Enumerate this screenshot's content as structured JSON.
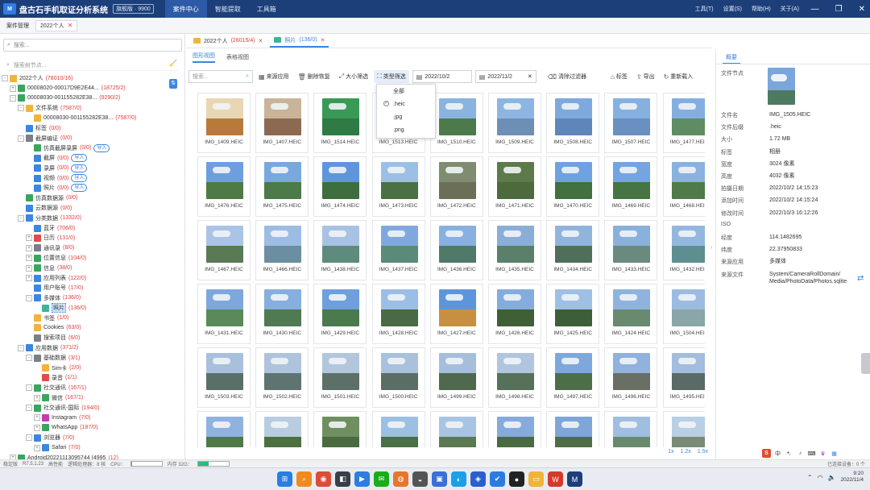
{
  "titlebar": {
    "app_title": "盘古石手机取证分析系统",
    "version": "旗舰版 · 9900",
    "nav": [
      "案件中心",
      "智能提取",
      "工具箱"
    ],
    "right_menu": [
      "工具(T)",
      "设置(S)",
      "帮助(H)",
      "关于(A)"
    ]
  },
  "breadcrumb": {
    "items": [
      "案件管理",
      "2022个人"
    ]
  },
  "left": {
    "search_placeholder": "搜索...",
    "tree_search_placeholder": "搜索树节点...",
    "tree": [
      {
        "label": "2022个人",
        "count": "(78010/16)",
        "indent": 0,
        "toggle": "-",
        "color": "#f0b43c"
      },
      {
        "label": "00008020-00017D9E2E44...",
        "count": "(18725/2)",
        "indent": 1,
        "toggle": "+",
        "color": "#3aa55d"
      },
      {
        "label": "00008030-001155282E38...",
        "count": "(9290/2)",
        "indent": 1,
        "toggle": "-",
        "color": "#3aa55d"
      },
      {
        "label": "文件系统",
        "count": "(7587/0)",
        "indent": 2,
        "toggle": "-",
        "color": "#f0b43c"
      },
      {
        "label": "00008030-001155282E38...",
        "count": "(7587/0)",
        "indent": 3,
        "toggle": "",
        "color": "#f0b43c"
      },
      {
        "label": "标签",
        "count": "(0/0)",
        "indent": 2,
        "toggle": "",
        "color": "#3b87e0"
      },
      {
        "label": "截屏编证",
        "count": "(0/0)",
        "indent": 2,
        "toggle": "-",
        "color": "#7a7f88"
      },
      {
        "label": "仿真截屏录屏",
        "count": "(0/0)",
        "indent": 3,
        "toggle": "",
        "color": "#3aa55d",
        "import": "导入"
      },
      {
        "label": "截屏",
        "count": "(0/0)",
        "indent": 3,
        "toggle": "",
        "color": "#3b87e0",
        "import": "导入"
      },
      {
        "label": "录屏",
        "count": "(0/0)",
        "indent": 3,
        "toggle": "",
        "color": "#3b87e0",
        "import": "导入"
      },
      {
        "label": "视频",
        "count": "(0/0)",
        "indent": 3,
        "toggle": "",
        "color": "#3b87e0",
        "import": "导入"
      },
      {
        "label": "照片",
        "count": "(0/0)",
        "indent": 3,
        "toggle": "",
        "color": "#3b87e0",
        "import": "导入"
      },
      {
        "label": "仿真数据源",
        "count": "(0/0)",
        "indent": 2,
        "toggle": "",
        "color": "#3aa55d"
      },
      {
        "label": "云数据源",
        "count": "(0/0)",
        "indent": 2,
        "toggle": "",
        "color": "#3b87e0"
      },
      {
        "label": "分类数据",
        "count": "(1332/0)",
        "indent": 2,
        "toggle": "-",
        "color": "#3b87e0"
      },
      {
        "label": "蓝牙",
        "count": "(706/0)",
        "indent": 3,
        "toggle": "",
        "color": "#3b87e0"
      },
      {
        "label": "日历",
        "count": "(131/0)",
        "indent": 3,
        "toggle": "+",
        "color": "#e24b4b"
      },
      {
        "label": "通讯录",
        "count": "(8/0)",
        "indent": 3,
        "toggle": "+",
        "color": "#7a7f88"
      },
      {
        "label": "位置信息",
        "count": "(104/0)",
        "indent": 3,
        "toggle": "+",
        "color": "#3aa55d"
      },
      {
        "label": "信息",
        "count": "(38/0)",
        "indent": 3,
        "toggle": "+",
        "color": "#3aa55d"
      },
      {
        "label": "应用列表",
        "count": "(122/0)",
        "indent": 3,
        "toggle": "+",
        "color": "#3b87e0"
      },
      {
        "label": "用户账号",
        "count": "(17/0)",
        "indent": 3,
        "toggle": "",
        "color": "#3b87e0"
      },
      {
        "label": "多媒体",
        "count": "(136/0)",
        "indent": 3,
        "toggle": "-",
        "color": "#3b87e0"
      },
      {
        "label": "照片",
        "count": "(136/0)",
        "indent": 4,
        "toggle": "",
        "color": "#3fb29a",
        "selected": true
      },
      {
        "label": "书签",
        "count": "(1/0)",
        "indent": 3,
        "toggle": "",
        "color": "#f0b43c"
      },
      {
        "label": "Cookies",
        "count": "(63/0)",
        "indent": 3,
        "toggle": "",
        "color": "#f0b43c"
      },
      {
        "label": "搜索项目",
        "count": "(6/0)",
        "indent": 3,
        "toggle": "",
        "color": "#7a7f88"
      },
      {
        "label": "应用数据",
        "count": "(371/2)",
        "indent": 2,
        "toggle": "-",
        "color": "#3b87e0"
      },
      {
        "label": "基础数据",
        "count": "(3/1)",
        "indent": 3,
        "toggle": "-",
        "color": "#7a7f88"
      },
      {
        "label": "Sim卡",
        "count": "(2/0)",
        "indent": 4,
        "toggle": "",
        "color": "#f0b43c"
      },
      {
        "label": "录音",
        "count": "(1/1)",
        "indent": 4,
        "toggle": "",
        "color": "#e24b4b"
      },
      {
        "label": "社交通讯",
        "count": "(167/1)",
        "indent": 3,
        "toggle": "-",
        "color": "#3aa55d"
      },
      {
        "label": "微信",
        "count": "(167/1)",
        "indent": 4,
        "toggle": "+",
        "color": "#3aa55d"
      },
      {
        "label": "社交通讯-国际",
        "count": "(194/0)",
        "indent": 3,
        "toggle": "-",
        "color": "#3aa55d"
      },
      {
        "label": "Instagram",
        "count": "(7/0)",
        "indent": 4,
        "toggle": "+",
        "color": "#c63cb0"
      },
      {
        "label": "WhatsApp",
        "count": "(187/0)",
        "indent": 4,
        "toggle": "+",
        "color": "#3aa55d"
      },
      {
        "label": "浏览器",
        "count": "(7/0)",
        "indent": 3,
        "toggle": "-",
        "color": "#3b87e0"
      },
      {
        "label": "Safari",
        "count": "(7/0)",
        "indent": 4,
        "toggle": "+",
        "color": "#3b87e0"
      },
      {
        "label": "Android20221113095744 (4995",
        "count": "(12)",
        "indent": 1,
        "toggle": "+",
        "color": "#3aa55d"
      }
    ]
  },
  "center": {
    "doc_tabs": [
      {
        "label": "2022个人",
        "count": "(28015/4)"
      },
      {
        "label": "照片",
        "count": "(136/0)"
      }
    ],
    "view_tabs": [
      "图形视图",
      "表格视图"
    ],
    "toolbar": {
      "search_placeholder": "搜索...",
      "source_app": "来源应用",
      "delete_recover": "删除恢复",
      "size_filter": "大小筛选",
      "type_filter": "类型筛选",
      "date_start": "2022/10/2",
      "date_end": "2022/11/2",
      "clear_filter": "清除过滤器",
      "tag": "标签",
      "export": "导出",
      "reload": "重新载入"
    },
    "type_dropdown": [
      {
        "label": "全部",
        "checked": false
      },
      {
        "label": ".heic",
        "checked": true
      },
      {
        "label": ".jpg",
        "checked": false
      },
      {
        "label": ".png",
        "checked": false
      }
    ],
    "thumbnails": [
      {
        "name": "IMG_1409.HEIC",
        "sky": "#e9d6b4",
        "land": "#b87a3a"
      },
      {
        "name": "IMG_1407.HEIC",
        "sky": "#c9b49a",
        "land": "#8c6a52"
      },
      {
        "name": "IMG_1514.HEIC",
        "sky": "#3a9a55",
        "land": "#2f7a45"
      },
      {
        "name": "IMG_1513.HEIC",
        "sky": "#7aa6d6",
        "land": "#4f6e3f"
      },
      {
        "name": "IMG_1510.HEIC",
        "sky": "#89b4e0",
        "land": "#4d7a4a"
      },
      {
        "name": "IMG_1509.HEIC",
        "sky": "#8db5e2",
        "land": "#6d8fb5"
      },
      {
        "name": "IMG_1508.HEIC",
        "sky": "#7ea9dc",
        "land": "#5e86b8"
      },
      {
        "name": "IMG_1507.HEIC",
        "sky": "#86b0e0",
        "land": "#6990c0"
      },
      {
        "name": "IMG_1477.HEIC",
        "sky": "#84aee0",
        "land": "#5f8c62"
      },
      {
        "name": "IMG_1476.HEIC",
        "sky": "#6d9fde",
        "land": "#4f7a44"
      },
      {
        "name": "IMG_1475.HEIC",
        "sky": "#79a8df",
        "land": "#4c7a48"
      },
      {
        "name": "IMG_1474.HEIC",
        "sky": "#5f96db",
        "land": "#3f6e3e"
      },
      {
        "name": "IMG_1473.HEIC",
        "sky": "#9cbfe6",
        "land": "#4a7044"
      },
      {
        "name": "IMG_1472.HEIC",
        "sky": "#7f8c70",
        "land": "#6b6f58"
      },
      {
        "name": "IMG_1471.HEIC",
        "sky": "#5c7a4a",
        "land": "#4d6a3d"
      },
      {
        "name": "IMG_1470.HEIC",
        "sky": "#6fa2e0",
        "land": "#42703f"
      },
      {
        "name": "IMG_1469.HEIC",
        "sky": "#74a5e0",
        "land": "#467443"
      },
      {
        "name": "IMG_1468.HEIC",
        "sky": "#8ab1e0",
        "land": "#4f7a4a"
      },
      {
        "name": "IMG_1467.HEIC",
        "sky": "#a9c4e6",
        "land": "#5a7a55"
      },
      {
        "name": "IMG_1466.HEIC",
        "sky": "#9dbce4",
        "land": "#6b8fa0"
      },
      {
        "name": "IMG_1438.HEIC",
        "sky": "#a7c2e4",
        "land": "#5f8a7e"
      },
      {
        "name": "IMG_1437.HEIC",
        "sky": "#7fa9de",
        "land": "#5a8a78"
      },
      {
        "name": "IMG_1436.HEIC",
        "sky": "#88b0e0",
        "land": "#4f7a6a"
      },
      {
        "name": "IMG_1435.HEIC",
        "sky": "#8aaed8",
        "land": "#5a7f6a"
      },
      {
        "name": "IMG_1434.HEIC",
        "sky": "#91b4dc",
        "land": "#4f6f5a"
      },
      {
        "name": "IMG_1433.HEIC",
        "sky": "#8ab0dc",
        "land": "#6a8a80"
      },
      {
        "name": "IMG_1432.HEIC",
        "sky": "#94b7e0",
        "land": "#5d8f90"
      },
      {
        "name": "IMG_1431.HEIC",
        "sky": "#7ea8dc",
        "land": "#5a8a5a"
      },
      {
        "name": "IMG_1430.HEIC",
        "sky": "#86aede",
        "land": "#4f7a52"
      },
      {
        "name": "IMG_1429.HEIC",
        "sky": "#6f9fdc",
        "land": "#4a7a4e"
      },
      {
        "name": "IMG_1428.HEIC",
        "sky": "#9cbde6",
        "land": "#4a6a45"
      },
      {
        "name": "IMG_1427.HEIC",
        "sky": "#5d95dc",
        "land": "#c78f42"
      },
      {
        "name": "IMG_1426.HEIC",
        "sky": "#84acdc",
        "land": "#3f5f35"
      },
      {
        "name": "IMG_1425.HEIC",
        "sky": "#9fbfe4",
        "land": "#3d5e38"
      },
      {
        "name": "IMG_1424.HEIC",
        "sky": "#8fb3de",
        "land": "#6a8a6f"
      },
      {
        "name": "IMG_1504.HEIC",
        "sky": "#9cbbe0",
        "land": "#8aa6a8"
      },
      {
        "name": "IMG_1503.HEIC",
        "sky": "#a8c0dc",
        "land": "#5a6f68"
      },
      {
        "name": "IMG_1502.HEIC",
        "sky": "#aec4dc",
        "land": "#5f7470"
      },
      {
        "name": "IMG_1501.HEIC",
        "sky": "#b2c6dc",
        "land": "#5d7068"
      },
      {
        "name": "IMG_1500.HEIC",
        "sky": "#a9c1dc",
        "land": "#5a6e66"
      },
      {
        "name": "IMG_1499.HEIC",
        "sky": "#a4bedc",
        "land": "#50684e"
      },
      {
        "name": "IMG_1498.HEIC",
        "sky": "#b0c6de",
        "land": "#56705a"
      },
      {
        "name": "IMG_1497.HEIC",
        "sky": "#7ea8dc",
        "land": "#4d6f48"
      },
      {
        "name": "IMG_1496.HEIC",
        "sky": "#90b2dc",
        "land": "#6a6f66"
      },
      {
        "name": "IMG_1495.HEIC",
        "sky": "#a3bddc",
        "land": "#5a6a66"
      },
      {
        "name": "",
        "sky": "#8fb3de",
        "land": "#4f7a45"
      },
      {
        "name": "",
        "sky": "#b8cde0",
        "land": "#4d7040"
      },
      {
        "name": "",
        "sky": "#6f8f60",
        "land": "#4a6a40"
      },
      {
        "name": "",
        "sky": "#9cbfe4",
        "land": "#4a7045"
      },
      {
        "name": "",
        "sky": "#a8c4e4",
        "land": "#5b7a52"
      },
      {
        "name": "",
        "sky": "#86aadc",
        "land": "#4a6a42"
      },
      {
        "name": "",
        "sky": "#7ea6d8",
        "land": "#4f6e45"
      },
      {
        "name": "",
        "sky": "#a0bee0",
        "land": "#6a8a70"
      },
      {
        "name": "",
        "sky": "#b9cfe4",
        "land": "#7a8a78"
      }
    ],
    "zoom": [
      "1x",
      "1.2x",
      "1.5x"
    ]
  },
  "details": {
    "tab": "概要",
    "node_label": "文件节点",
    "rows": [
      {
        "k": "文件名",
        "v": "IMG_1505.HEIC"
      },
      {
        "k": "文件后缀",
        "v": ".heic"
      },
      {
        "k": "大小",
        "v": "1.72 MB"
      },
      {
        "k": "标签",
        "v": "相册"
      },
      {
        "k": "宽度",
        "v": "3024 像素"
      },
      {
        "k": "高度",
        "v": "4032 像素"
      },
      {
        "k": "拍摄日期",
        "v": "2022/10/2 14:15:23"
      },
      {
        "k": "添加时间",
        "v": "2022/10/2 14:15:24"
      },
      {
        "k": "修改时间",
        "v": "2022/10/3 16:12:26"
      },
      {
        "k": "ISO",
        "v": ""
      },
      {
        "k": "经度",
        "v": "114.1482695"
      },
      {
        "k": "纬度",
        "v": "22.37950833"
      },
      {
        "k": "来源应用",
        "v": "多媒体"
      },
      {
        "k": "来源文件",
        "v": "System/CameraRollDomain/\nMedia/PhotoData/Photos.sqlite"
      }
    ]
  },
  "status": {
    "left": "稳定版",
    "version": "R7.5.1.23",
    "mode": "高性能",
    "threads": "逻辑处理器：8 核",
    "cpu_label": "CPU：",
    "mem_label": "内存 32G：",
    "right": "已连接设备：0 个"
  },
  "taskbar": {
    "time": "9:20",
    "date": "2022/11/4"
  }
}
